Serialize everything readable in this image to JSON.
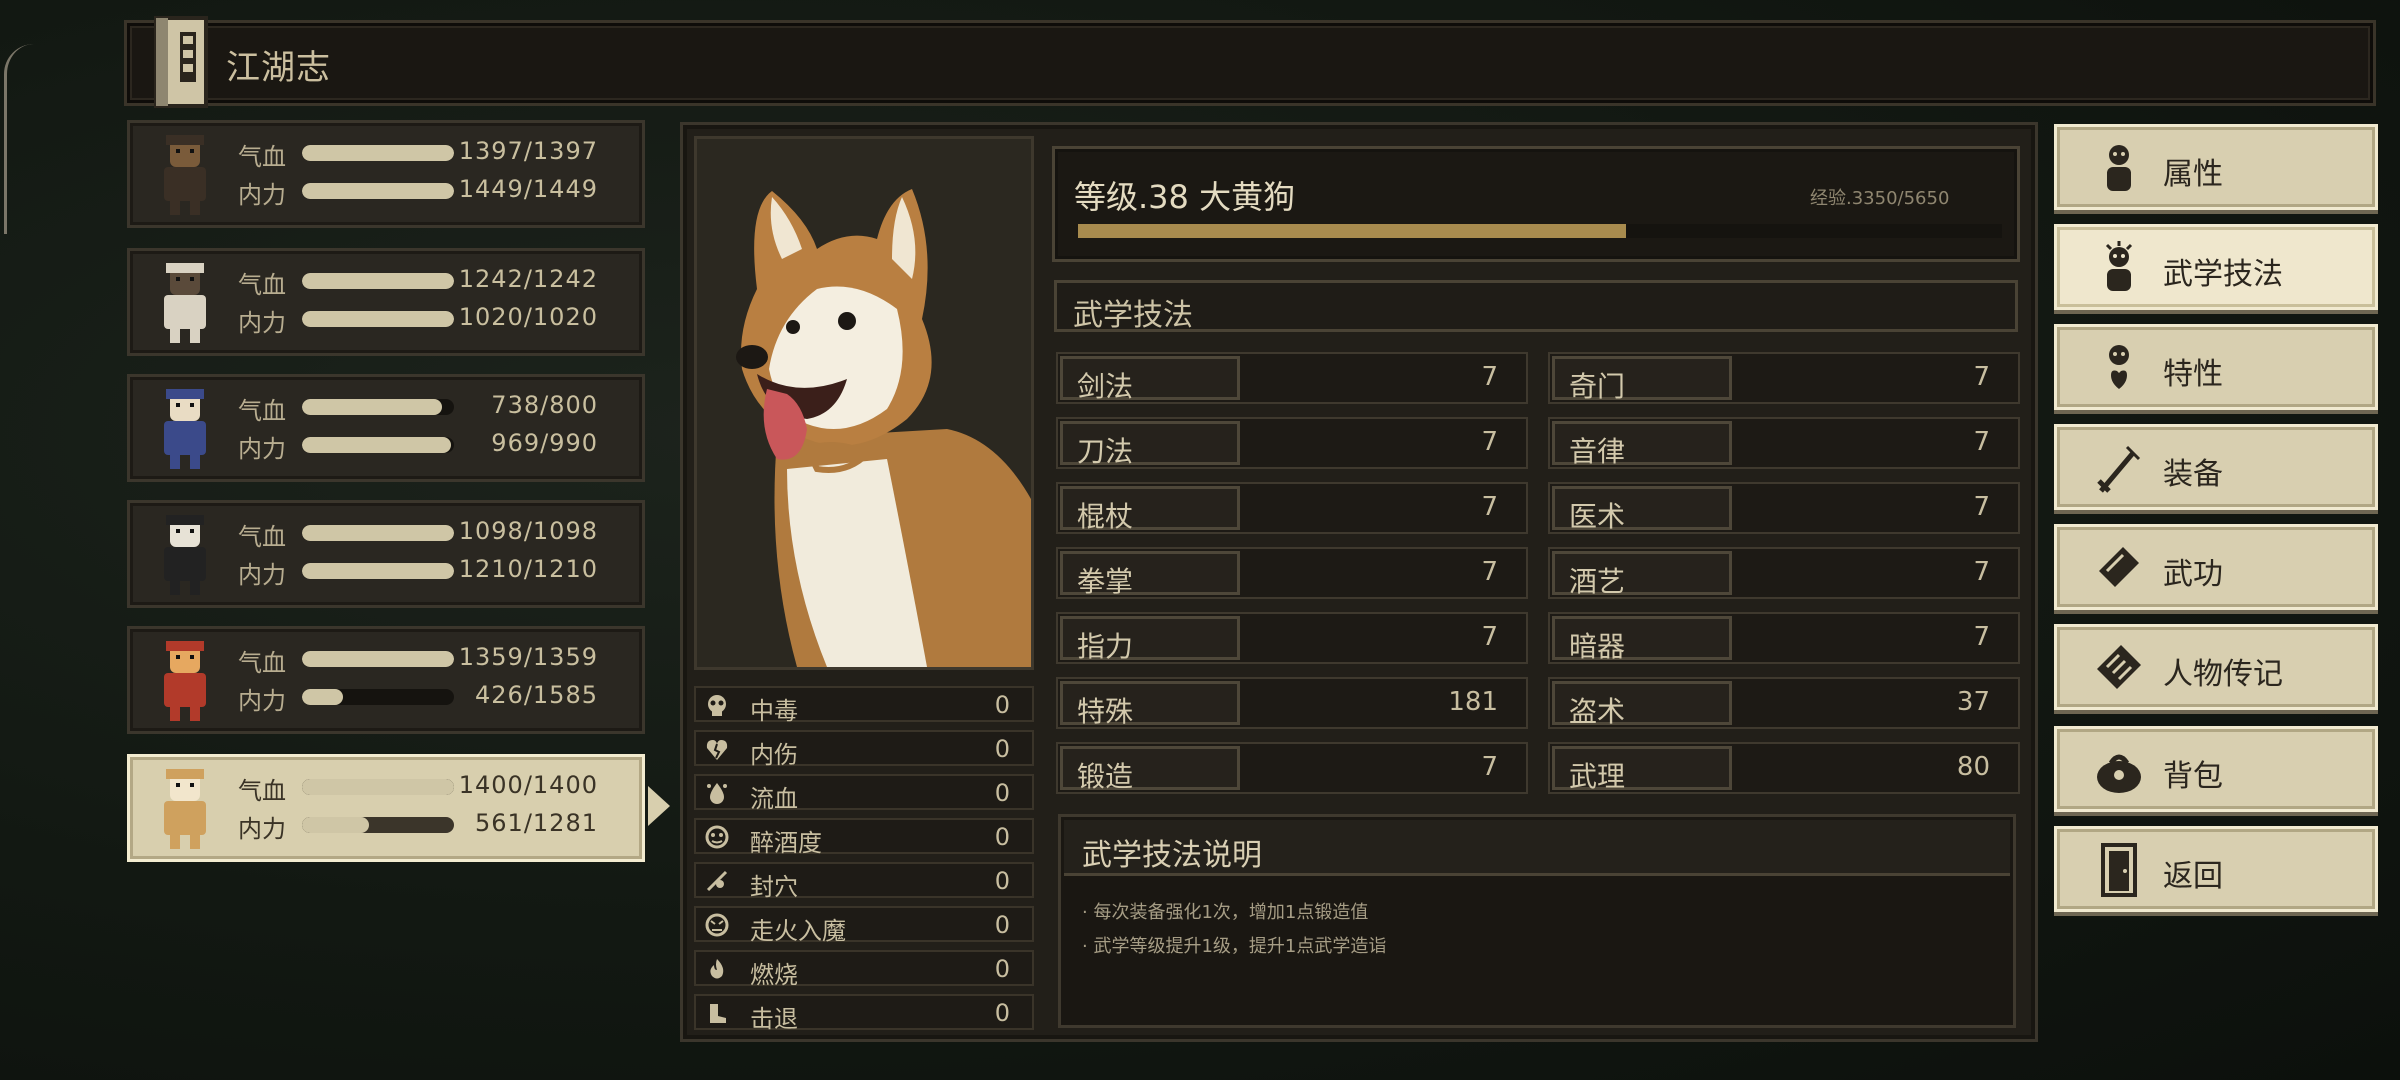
{
  "header": {
    "title": "江湖志"
  },
  "party": [
    {
      "hp_label": "气血",
      "mp_label": "内力",
      "hp": "1397/1397",
      "mp": "1449/1449",
      "hp_frac": 1.0,
      "mp_frac": 1.0
    },
    {
      "hp_label": "气血",
      "mp_label": "内力",
      "hp": "1242/1242",
      "mp": "1020/1020",
      "hp_frac": 1.0,
      "mp_frac": 1.0
    },
    {
      "hp_label": "气血",
      "mp_label": "内力",
      "hp": "738/800",
      "mp": "969/990",
      "hp_frac": 0.92,
      "mp_frac": 0.98
    },
    {
      "hp_label": "气血",
      "mp_label": "内力",
      "hp": "1098/1098",
      "mp": "1210/1210",
      "hp_frac": 1.0,
      "mp_frac": 1.0
    },
    {
      "hp_label": "气血",
      "mp_label": "内力",
      "hp": "1359/1359",
      "mp": "426/1585",
      "hp_frac": 1.0,
      "mp_frac": 0.27
    },
    {
      "hp_label": "气血",
      "mp_label": "内力",
      "hp": "1400/1400",
      "mp": "561/1281",
      "hp_frac": 1.0,
      "mp_frac": 0.44
    }
  ],
  "character": {
    "level_text": "等级.38 大黄狗",
    "exp_text": "经验.3350/5650",
    "exp_frac": 0.593
  },
  "status_effects": [
    {
      "name": "中毒",
      "value": "0",
      "icon": "skull-icon"
    },
    {
      "name": "内伤",
      "value": "0",
      "icon": "broken-heart-icon"
    },
    {
      "name": "流血",
      "value": "0",
      "icon": "blood-icon"
    },
    {
      "name": "醉酒度",
      "value": "0",
      "icon": "drunk-icon"
    },
    {
      "name": "封穴",
      "value": "0",
      "icon": "acupoint-icon"
    },
    {
      "name": "走火入魔",
      "value": "0",
      "icon": "demon-icon"
    },
    {
      "name": "燃烧",
      "value": "0",
      "icon": "fire-icon"
    },
    {
      "name": "击退",
      "value": "0",
      "icon": "boot-icon"
    }
  ],
  "skills_section": {
    "title": "武学技法"
  },
  "skills": [
    {
      "name": "剑法",
      "value": "7"
    },
    {
      "name": "奇门",
      "value": "7"
    },
    {
      "name": "刀法",
      "value": "7"
    },
    {
      "name": "音律",
      "value": "7"
    },
    {
      "name": "棍杖",
      "value": "7"
    },
    {
      "name": "医术",
      "value": "7"
    },
    {
      "name": "拳掌",
      "value": "7"
    },
    {
      "name": "酒艺",
      "value": "7"
    },
    {
      "name": "指力",
      "value": "7"
    },
    {
      "name": "暗器",
      "value": "7"
    },
    {
      "name": "特殊",
      "value": "181"
    },
    {
      "name": "盗术",
      "value": "37"
    },
    {
      "name": "锻造",
      "value": "7"
    },
    {
      "name": "武理",
      "value": "80"
    }
  ],
  "description": {
    "title": "武学技法说明",
    "lines": [
      "· 每次装备强化1次，增加1点锻造值",
      "· 武学等级提升1级，提升1点武学造诣"
    ]
  },
  "menu": [
    {
      "label": "属性",
      "icon": "person-icon"
    },
    {
      "label": "武学技法",
      "icon": "martial-person-icon"
    },
    {
      "label": "特性",
      "icon": "trait-person-icon"
    },
    {
      "label": "装备",
      "icon": "sword-icon"
    },
    {
      "label": "武功",
      "icon": "book-icon"
    },
    {
      "label": "人物传记",
      "icon": "scroll-icon"
    },
    {
      "label": "背包",
      "icon": "bag-icon"
    },
    {
      "label": "返回",
      "icon": "door-icon"
    }
  ],
  "colors": {
    "bar_fill": "#cfc6a6",
    "exp_fill": "#a88b4e",
    "menu_bg": "#d8cfb0"
  }
}
